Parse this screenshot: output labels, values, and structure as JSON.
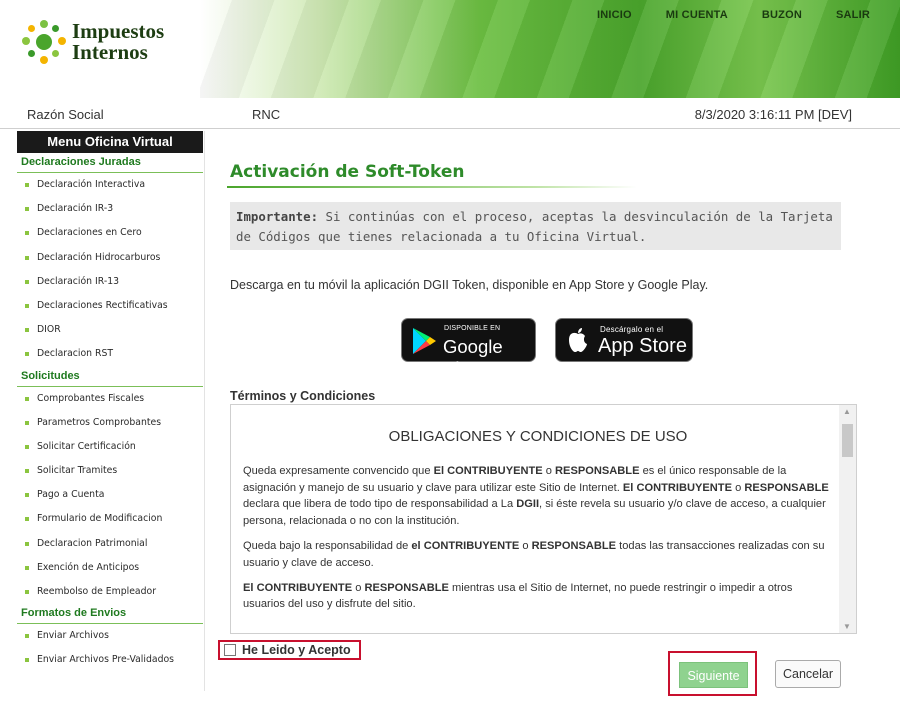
{
  "header": {
    "logo_line1": "Impuestos",
    "logo_line2": "Internos",
    "nav": [
      "INICIO",
      "MI CUENTA",
      "BUZON",
      "SALIR"
    ]
  },
  "infobar": {
    "razon_social": "Razón Social",
    "rnc": "RNC",
    "datetime": "8/3/2020 3:16:11 PM  [DEV]"
  },
  "sidebar": {
    "title": "Menu Oficina Virtual",
    "sections": [
      {
        "title": "Declaraciones Juradas",
        "items": [
          "Declaración Interactiva",
          "Declaración IR-3",
          "Declaraciones en Cero",
          "Declaración Hidrocarburos",
          "Declaración IR-13",
          "Declaraciones Rectificativas",
          "DIOR",
          "Declaracion RST"
        ]
      },
      {
        "title": "Solicitudes",
        "items": [
          "Comprobantes Fiscales",
          "Parametros Comprobantes",
          "Solicitar Certificación",
          "Solicitar Tramites",
          "Pago a Cuenta",
          "Formulario de Modificacion",
          "Declaracion Patrimonial",
          "Exención de Anticipos",
          "Reembolso de Empleador"
        ]
      },
      {
        "title": "Formatos de Envios",
        "items": [
          "Enviar Archivos",
          "Enviar Archivos Pre-Validados"
        ]
      }
    ]
  },
  "main": {
    "title": "Activación de Soft-Token",
    "notice_bold": "Importante:",
    "notice_text": " Si continúas con el proceso, aceptas la desvinculación de la Tarjeta de Códigos que tienes relacionada a tu Oficina Virtual.",
    "download_text": "Descarga en tu móvil la aplicación DGII Token, disponible en App Store y Google Play.",
    "google_small": "DISPONIBLE EN",
    "google_big": "Google Play",
    "apple_small": "Descárgalo en el",
    "apple_big": "App Store",
    "terms_label": "Términos y Condiciones",
    "terms_heading": "OBLIGACIONES Y CONDICIONES DE USO",
    "terms_p1": [
      {
        "t": "Queda expresamente convencido que ",
        "b": false
      },
      {
        "t": "El CONTRIBUYENTE",
        "b": true
      },
      {
        "t": " o ",
        "b": false
      },
      {
        "t": "RESPONSABLE",
        "b": true
      },
      {
        "t": " es el único responsable de la asignación y manejo de su usuario y clave para utilizar este Sitio de Internet. ",
        "b": false
      },
      {
        "t": "El CONTRIBUYENTE",
        "b": true
      },
      {
        "t": " o ",
        "b": false
      },
      {
        "t": "RESPONSABLE",
        "b": true
      },
      {
        "t": " declara que libera de todo tipo de responsabilidad a La ",
        "b": false
      },
      {
        "t": "DGII",
        "b": true
      },
      {
        "t": ", si éste revela su usuario y/o clave de acceso, a cualquier persona, relacionada o no con la institución.",
        "b": false
      }
    ],
    "terms_p2": [
      {
        "t": "Queda bajo la responsabilidad de ",
        "b": false
      },
      {
        "t": "el CONTRIBUYENTE",
        "b": true
      },
      {
        "t": " o ",
        "b": false
      },
      {
        "t": "RESPONSABLE",
        "b": true
      },
      {
        "t": " todas las transacciones realizadas con su usuario y clave de acceso.",
        "b": false
      }
    ],
    "terms_p3": [
      {
        "t": "El CONTRIBUYENTE",
        "b": true
      },
      {
        "t": " o ",
        "b": false
      },
      {
        "t": "RESPONSABLE",
        "b": true
      },
      {
        "t": " mientras usa el Sitio de Internet, no puede restringir o impedir a otros usuarios del uso y disfrute del sitio.",
        "b": false
      }
    ],
    "accept_label": "He Leido y Acepto",
    "next_label": "Siguiente",
    "cancel_label": "Cancelar"
  },
  "colors": {
    "brand_green": "#2e8b2a",
    "highlight_red": "#c8102e",
    "next_button": "#8fd28f"
  }
}
